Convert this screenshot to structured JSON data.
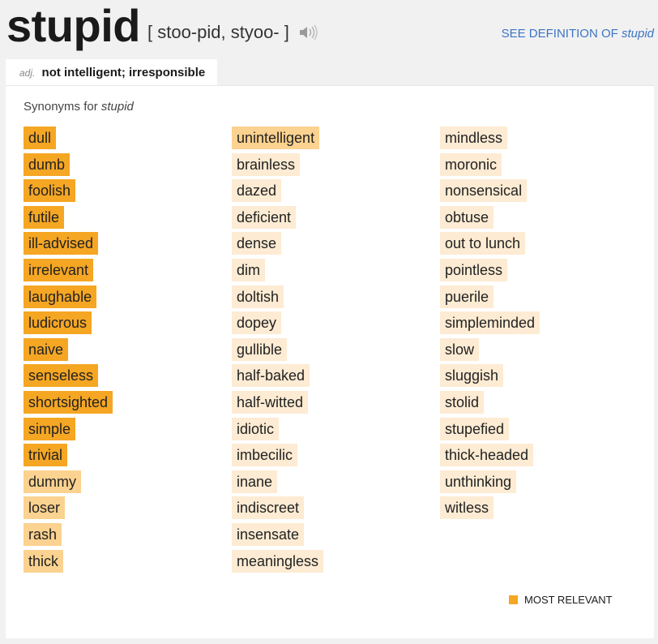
{
  "header": {
    "word": "stupid",
    "pronunciation": "[ stoo-pid, styoo- ]",
    "audio_icon": "speaker-icon",
    "see_definition_label": "SEE DEFINITION OF",
    "see_definition_word": "stupid"
  },
  "definition_tab": {
    "part_of_speech": "adj.",
    "gloss": "not intelligent; irresponsible"
  },
  "synonyms": {
    "heading": "Synonyms for",
    "heading_word": "stupid",
    "relevance_colors": {
      "high": "#f5a623",
      "medium": "#fbd28f",
      "low": "#fdebd3"
    },
    "columns": [
      [
        {
          "word": "dull",
          "relevance": "high"
        },
        {
          "word": "dumb",
          "relevance": "high"
        },
        {
          "word": "foolish",
          "relevance": "high"
        },
        {
          "word": "futile",
          "relevance": "high"
        },
        {
          "word": "ill-advised",
          "relevance": "high"
        },
        {
          "word": "irrelevant",
          "relevance": "high"
        },
        {
          "word": "laughable",
          "relevance": "high"
        },
        {
          "word": "ludicrous",
          "relevance": "high"
        },
        {
          "word": "naive",
          "relevance": "high"
        },
        {
          "word": "senseless",
          "relevance": "high"
        },
        {
          "word": "shortsighted",
          "relevance": "high"
        },
        {
          "word": "simple",
          "relevance": "high"
        },
        {
          "word": "trivial",
          "relevance": "high"
        },
        {
          "word": "dummy",
          "relevance": "medium"
        },
        {
          "word": "loser",
          "relevance": "medium"
        },
        {
          "word": "rash",
          "relevance": "medium"
        },
        {
          "word": "thick",
          "relevance": "medium"
        }
      ],
      [
        {
          "word": "unintelligent",
          "relevance": "medium"
        },
        {
          "word": "brainless",
          "relevance": "low"
        },
        {
          "word": "dazed",
          "relevance": "low"
        },
        {
          "word": "deficient",
          "relevance": "low"
        },
        {
          "word": "dense",
          "relevance": "low"
        },
        {
          "word": "dim",
          "relevance": "low"
        },
        {
          "word": "doltish",
          "relevance": "low"
        },
        {
          "word": "dopey",
          "relevance": "low"
        },
        {
          "word": "gullible",
          "relevance": "low"
        },
        {
          "word": "half-baked",
          "relevance": "low"
        },
        {
          "word": "half-witted",
          "relevance": "low"
        },
        {
          "word": "idiotic",
          "relevance": "low"
        },
        {
          "word": "imbecilic",
          "relevance": "low"
        },
        {
          "word": "inane",
          "relevance": "low"
        },
        {
          "word": "indiscreet",
          "relevance": "low"
        },
        {
          "word": "insensate",
          "relevance": "low"
        },
        {
          "word": "meaningless",
          "relevance": "low"
        }
      ],
      [
        {
          "word": "mindless",
          "relevance": "low"
        },
        {
          "word": "moronic",
          "relevance": "low"
        },
        {
          "word": "nonsensical",
          "relevance": "low"
        },
        {
          "word": "obtuse",
          "relevance": "low"
        },
        {
          "word": "out to lunch",
          "relevance": "low"
        },
        {
          "word": "pointless",
          "relevance": "low"
        },
        {
          "word": "puerile",
          "relevance": "low"
        },
        {
          "word": "simpleminded",
          "relevance": "low"
        },
        {
          "word": "slow",
          "relevance": "low"
        },
        {
          "word": "sluggish",
          "relevance": "low"
        },
        {
          "word": "stolid",
          "relevance": "low"
        },
        {
          "word": "stupefied",
          "relevance": "low"
        },
        {
          "word": "thick-headed",
          "relevance": "low"
        },
        {
          "word": "unthinking",
          "relevance": "low"
        },
        {
          "word": "witless",
          "relevance": "low"
        }
      ]
    ],
    "legend_label": "MOST RELEVANT"
  }
}
